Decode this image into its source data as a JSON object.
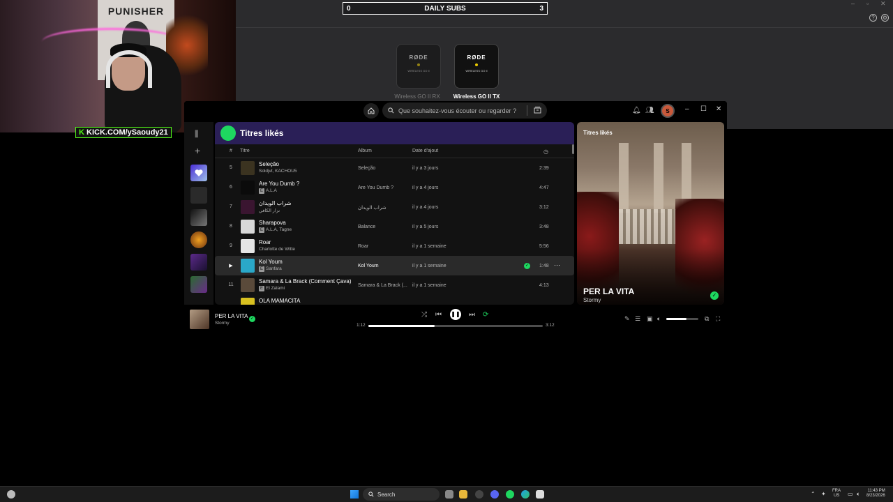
{
  "overlay": {
    "daily_subs": {
      "left": "0",
      "title": "DAILY SUBS",
      "right": "3"
    },
    "kick_handle": "KICK.COM/ySaoudy21",
    "poster_text": "PUNISHER"
  },
  "rode": {
    "devices": [
      {
        "brand": "RØDE",
        "sub": "WIRELESS GO II",
        "label": "Wireless GO II RX"
      },
      {
        "brand": "RØDE",
        "sub": "WIRELESS GO II",
        "label": "Wireless GO II TX"
      }
    ]
  },
  "spotify": {
    "search_placeholder": "Que souhaitez-vous écouter ou regarder ?",
    "avatar_letter": "S",
    "playlist_title": "Titres likés",
    "columns": {
      "num": "#",
      "title": "Titre",
      "album": "Album",
      "date": "Date d'ajout"
    },
    "tracks": [
      {
        "num": "5",
        "title": "Seleção",
        "artist": "Soldjvt, KACHOU5",
        "explicit": false,
        "album": "Seleção",
        "date": "il y a 3 jours",
        "duration": "2:39",
        "color": "#3b3320"
      },
      {
        "num": "6",
        "title": "Are You Dumb ?",
        "artist": "A.L.A",
        "explicit": true,
        "album": "Are You Dumb ?",
        "date": "il y a 4 jours",
        "duration": "4:47",
        "color": "#0b0b0b"
      },
      {
        "num": "7",
        "title": "شراب الويدان",
        "artist": "نزار الكافي",
        "explicit": false,
        "album": "شراب الويدان",
        "date": "il y a 4 jours",
        "duration": "3:12",
        "color": "#3a1530"
      },
      {
        "num": "8",
        "title": "Sharapova",
        "artist": "A.L.A, Tagne",
        "explicit": true,
        "album": "Balance",
        "date": "il y a 5 jours",
        "duration": "3:48",
        "color": "#d8d8d8"
      },
      {
        "num": "9",
        "title": "Roar",
        "artist": "Charlotte de Witte",
        "explicit": false,
        "album": "Roar",
        "date": "il y a 1 semaine",
        "duration": "5:56",
        "color": "#e5e5e5"
      },
      {
        "num": "▶",
        "title": "Kol Youm",
        "artist": "Sanfara",
        "explicit": true,
        "album": "Kol Youm",
        "date": "il y a 1 semaine",
        "duration": "1:48",
        "color": "#2aa8c8"
      },
      {
        "num": "11",
        "title": "Samara & La Brack (Comment Çava)",
        "artist": "El Zalami",
        "explicit": true,
        "album": "Samara & La Brack (...",
        "date": "il y a 1 semaine",
        "duration": "4:13",
        "color": "#5a4a3a"
      },
      {
        "num": "",
        "title": "OLA MAMACITA",
        "artist": "",
        "explicit": false,
        "album": "",
        "date": "",
        "duration": "",
        "color": "#d8c020"
      }
    ],
    "now_playing": {
      "panel_title": "Titres likés",
      "title": "PER LA VITA",
      "artist": "Stormy",
      "elapsed": "1:12",
      "total": "3:12",
      "progress": 0.38,
      "volume": 0.62
    }
  },
  "taskbar": {
    "search": "Search",
    "lang_top": "FRA",
    "lang_bottom": "US",
    "time": "11:43 PM",
    "date": "8/23/2026"
  }
}
